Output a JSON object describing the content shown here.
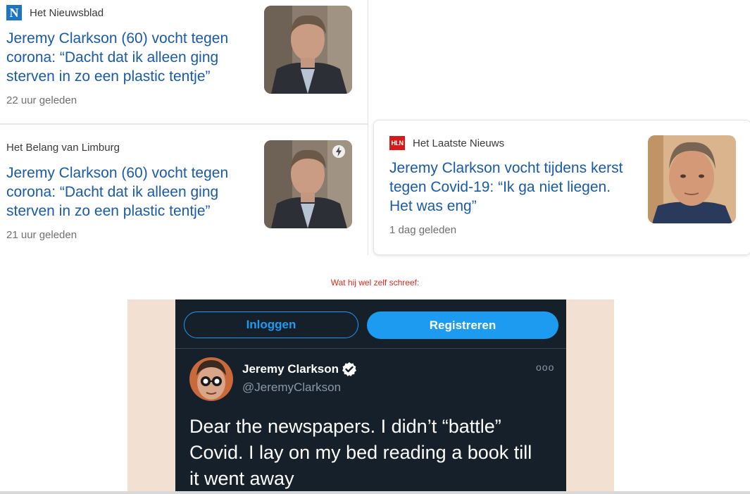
{
  "cards": [
    {
      "source": "Het Nieuwsblad",
      "logo": "N",
      "headline_lines": [
        "Jeremy Clarkson (60) vocht tegen",
        "corona: “Dacht dat ik alleen ging",
        "sterven in zo een plastic tentje”"
      ],
      "time": "22 uur geleden"
    },
    {
      "source": "Het Belang van Limburg",
      "headline_lines": [
        "Jeremy Clarkson (60) vocht tegen",
        "corona: “Dacht dat ik alleen ging",
        "sterven in zo een plastic tentje”"
      ],
      "time": "21 uur geleden"
    },
    {
      "source": "Het Laatste Nieuws",
      "logo": "HLN",
      "headline_lines": [
        "Jeremy Clarkson vocht tijdens kerst",
        "tegen Covid-19: “Ik ga niet liegen.",
        "Het was eng”"
      ],
      "time": "1 dag geleden"
    }
  ],
  "caption": "Wat hij wel zelf schreef:",
  "tweet": {
    "login_label": "Inloggen",
    "register_label": "Registreren",
    "author_name": "Jeremy Clarkson",
    "handle": "@JeremyClarkson",
    "more": "ooo",
    "text_lines": [
      "Dear the newspapers. I didn’t “battle”",
      "Covid. I lay on my bed reading a book till",
      "it went away"
    ]
  },
  "colors": {
    "headline": "#1a5aa6",
    "caption": "#e0281c",
    "twitter_blue": "#1d9bf0",
    "tweet_bg": "#15202b"
  }
}
